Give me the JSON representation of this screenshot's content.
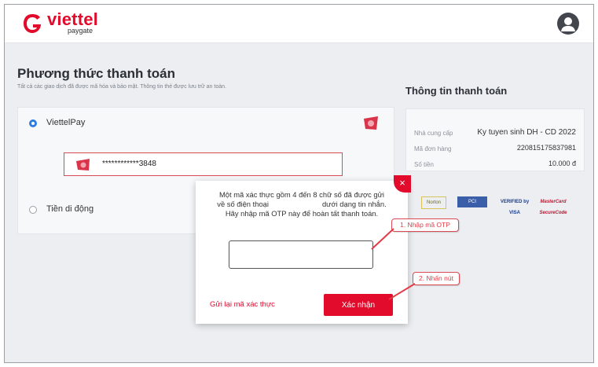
{
  "brand": {
    "name": "viettel",
    "sub": "paygate"
  },
  "page": {
    "title": "Phương thức thanh toán",
    "subtitle": "Tất cả các giao dịch đã được mã hóa và bảo mật. Thông tin thẻ được lưu trữ an toàn."
  },
  "methods": [
    {
      "label": "ViettelPay",
      "selected": true
    },
    {
      "label": "Tiền di động",
      "selected": false
    }
  ],
  "card": {
    "number": "************3848"
  },
  "summary": {
    "title": "Thông tin thanh toán",
    "rows": [
      {
        "label": "Nhà cung cấp",
        "value": "Ky tuyen sinh DH - CD 2022"
      },
      {
        "label": "Mã đơn hàng",
        "value": "220815175837981"
      },
      {
        "label": "Số tiền",
        "value": "10.000 đ"
      }
    ]
  },
  "badges": [
    "Norton",
    "PCI",
    "VERIFIED by VISA",
    "MasterCard SecureCode"
  ],
  "modal": {
    "line1": "Một mã xác thực gồm 4 đến 8 chữ số đã được gửi",
    "line2a": "về số điện thoại",
    "line2b": "dưới dạng tin nhắn.",
    "line3": "Hãy nhập mã OTP này để hoàn tất thanh toán.",
    "otp_value": "",
    "resend": "Gửi lại mã xác thực",
    "confirm": "Xác nhận",
    "close_symbol": "×"
  },
  "callouts": {
    "c1": "1. Nhập mã OTP",
    "c2": "2. Nhấn nút"
  },
  "colors": {
    "brand_red": "#e30b2b",
    "radio_blue": "#2f7de1",
    "callout_red": "#e23b46"
  }
}
